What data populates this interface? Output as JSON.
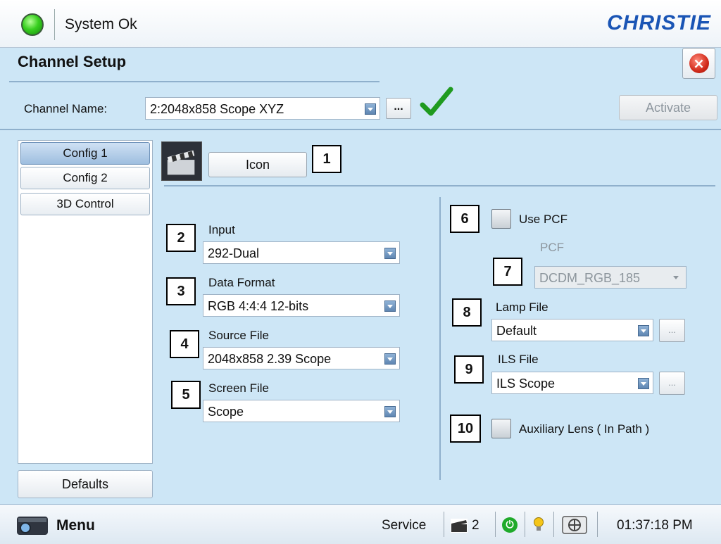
{
  "status": {
    "text": "System Ok",
    "led_color": "#2ecc20"
  },
  "brand": "CHRISTIE",
  "panel": {
    "title": "Channel Setup"
  },
  "channel": {
    "label": "Channel Name:",
    "value": "2:2048x858 Scope XYZ",
    "more_label": "...",
    "activate_label": "Activate"
  },
  "tabs": [
    {
      "label": "Config 1",
      "active": true
    },
    {
      "label": "Config 2",
      "active": false
    },
    {
      "label": "3D Control",
      "active": false
    }
  ],
  "defaults_label": "Defaults",
  "icon_button_label": "Icon",
  "callouts": [
    "1",
    "2",
    "3",
    "4",
    "5",
    "6",
    "7",
    "8",
    "9",
    "10"
  ],
  "fields": {
    "input": {
      "label": "Input",
      "value": "292-Dual"
    },
    "data_format": {
      "label": "Data Format",
      "value": "RGB 4:4:4 12-bits"
    },
    "source_file": {
      "label": "Source File",
      "value": "2048x858 2.39 Scope"
    },
    "screen_file": {
      "label": "Screen File",
      "value": "Scope"
    },
    "use_pcf": {
      "label": "Use PCF",
      "checked": false
    },
    "pcf": {
      "label": "PCF",
      "value": "DCDM_RGB_185",
      "disabled": true
    },
    "lamp_file": {
      "label": "Lamp File",
      "value": "Default",
      "more_label": "..."
    },
    "ils_file": {
      "label": "ILS File",
      "value": "ILS Scope",
      "more_label": "..."
    },
    "aux_lens": {
      "label": "Auxiliary Lens ( In Path )",
      "checked": false
    }
  },
  "bottom": {
    "menu_label": "Menu",
    "service_label": "Service",
    "channel_count": "2",
    "time": "01:37:18 PM"
  }
}
